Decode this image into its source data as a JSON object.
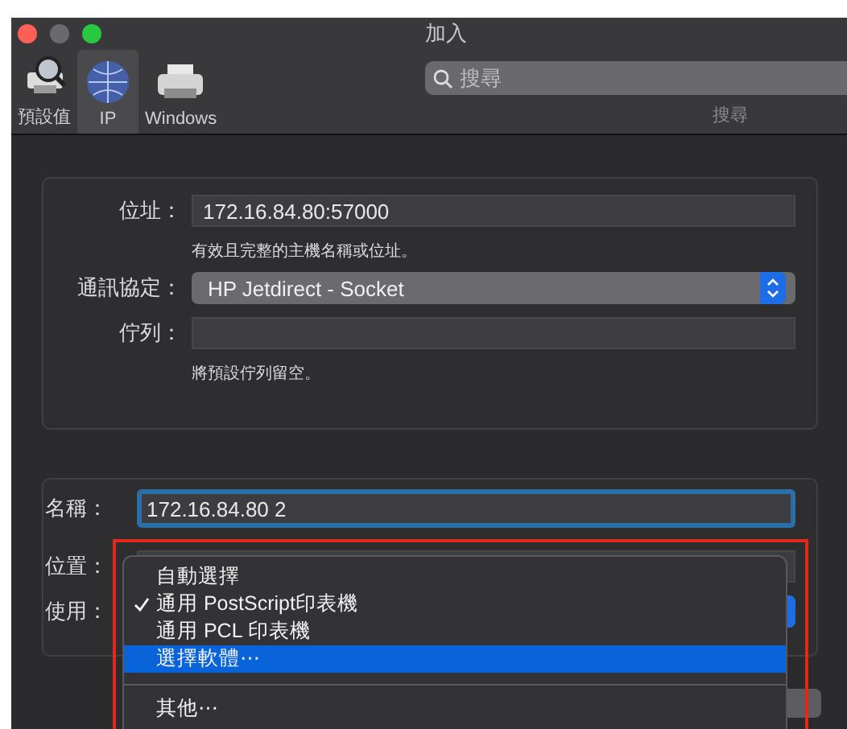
{
  "window": {
    "title": "加入"
  },
  "toolbar": {
    "tabs": [
      {
        "label": "預設值",
        "selected": false,
        "kind": "default"
      },
      {
        "label": "IP",
        "selected": true,
        "kind": "ip"
      },
      {
        "label": "Windows",
        "selected": false,
        "kind": "windows"
      }
    ],
    "search": {
      "placeholder": "搜尋",
      "label": "搜尋"
    }
  },
  "connection": {
    "address": {
      "label": "位址：",
      "value": "172.16.84.80:57000",
      "hint": "有效且完整的主機名稱或位址。"
    },
    "protocol": {
      "label": "通訊協定：",
      "value": "HP Jetdirect - Socket"
    },
    "queue": {
      "label": "佇列：",
      "hint": "將預設佇列留空。"
    }
  },
  "printer": {
    "name": {
      "label": "名稱：",
      "value": "172.16.84.80  2"
    },
    "location": {
      "label": "位置："
    },
    "use": {
      "label": "使用："
    }
  },
  "menu": {
    "items": [
      {
        "kind": "item",
        "label": "自動選擇",
        "checked": false,
        "selected": false
      },
      {
        "kind": "item",
        "label": "通用 PostScript印表機",
        "checked": true,
        "selected": false
      },
      {
        "kind": "item",
        "label": "通用 PCL 印表機",
        "checked": false,
        "selected": false
      },
      {
        "kind": "item",
        "label": "選擇軟體⋯",
        "checked": false,
        "selected": true
      },
      {
        "kind": "separator"
      },
      {
        "kind": "item",
        "label": "其他⋯",
        "checked": false,
        "selected": false
      }
    ]
  }
}
